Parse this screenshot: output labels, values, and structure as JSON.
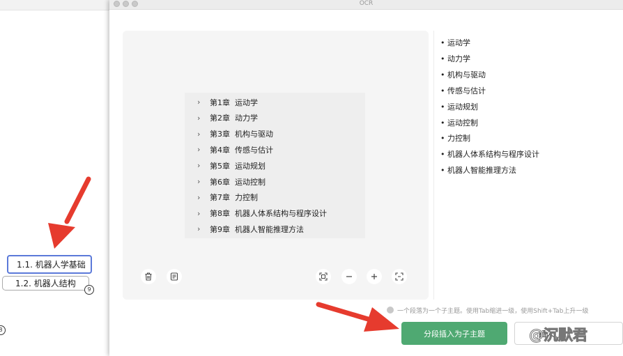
{
  "mindmap": {
    "node_1": "1.1. 机器人学基础",
    "node_2": "1.2. 机器人结构",
    "badge_node_2": "9",
    "badge_left": "8"
  },
  "window": {
    "title": "OCR"
  },
  "image_panel": {
    "chapters": [
      "第1章  运动学",
      "第2章  动力学",
      "第3章  机构与驱动",
      "第4章  传感与估计",
      "第5章  运动规划",
      "第6章  运动控制",
      "第7章  力控制",
      "第8章  机器人体系结构与程序设计",
      "第9章  机器人智能推理方法"
    ],
    "chevron": "›"
  },
  "results": [
    "运动学",
    "动力学",
    "机构与驱动",
    "传感与估计",
    "运动规划",
    "运动控制",
    "力控制",
    "机器人体系结构与程序设计",
    "机器人智能推理方法"
  ],
  "hint": "一个段落为一个子主题。使用Tab缩进一级，使用Shift+Tab上升一级",
  "buttons": {
    "insert": "分段插入为子主题",
    "secondary": "插入"
  },
  "watermark": "@沉默君",
  "colors": {
    "accent_green": "#4fa972",
    "selection_blue": "#5b79d9",
    "annotation_red": "#e63b2e"
  }
}
